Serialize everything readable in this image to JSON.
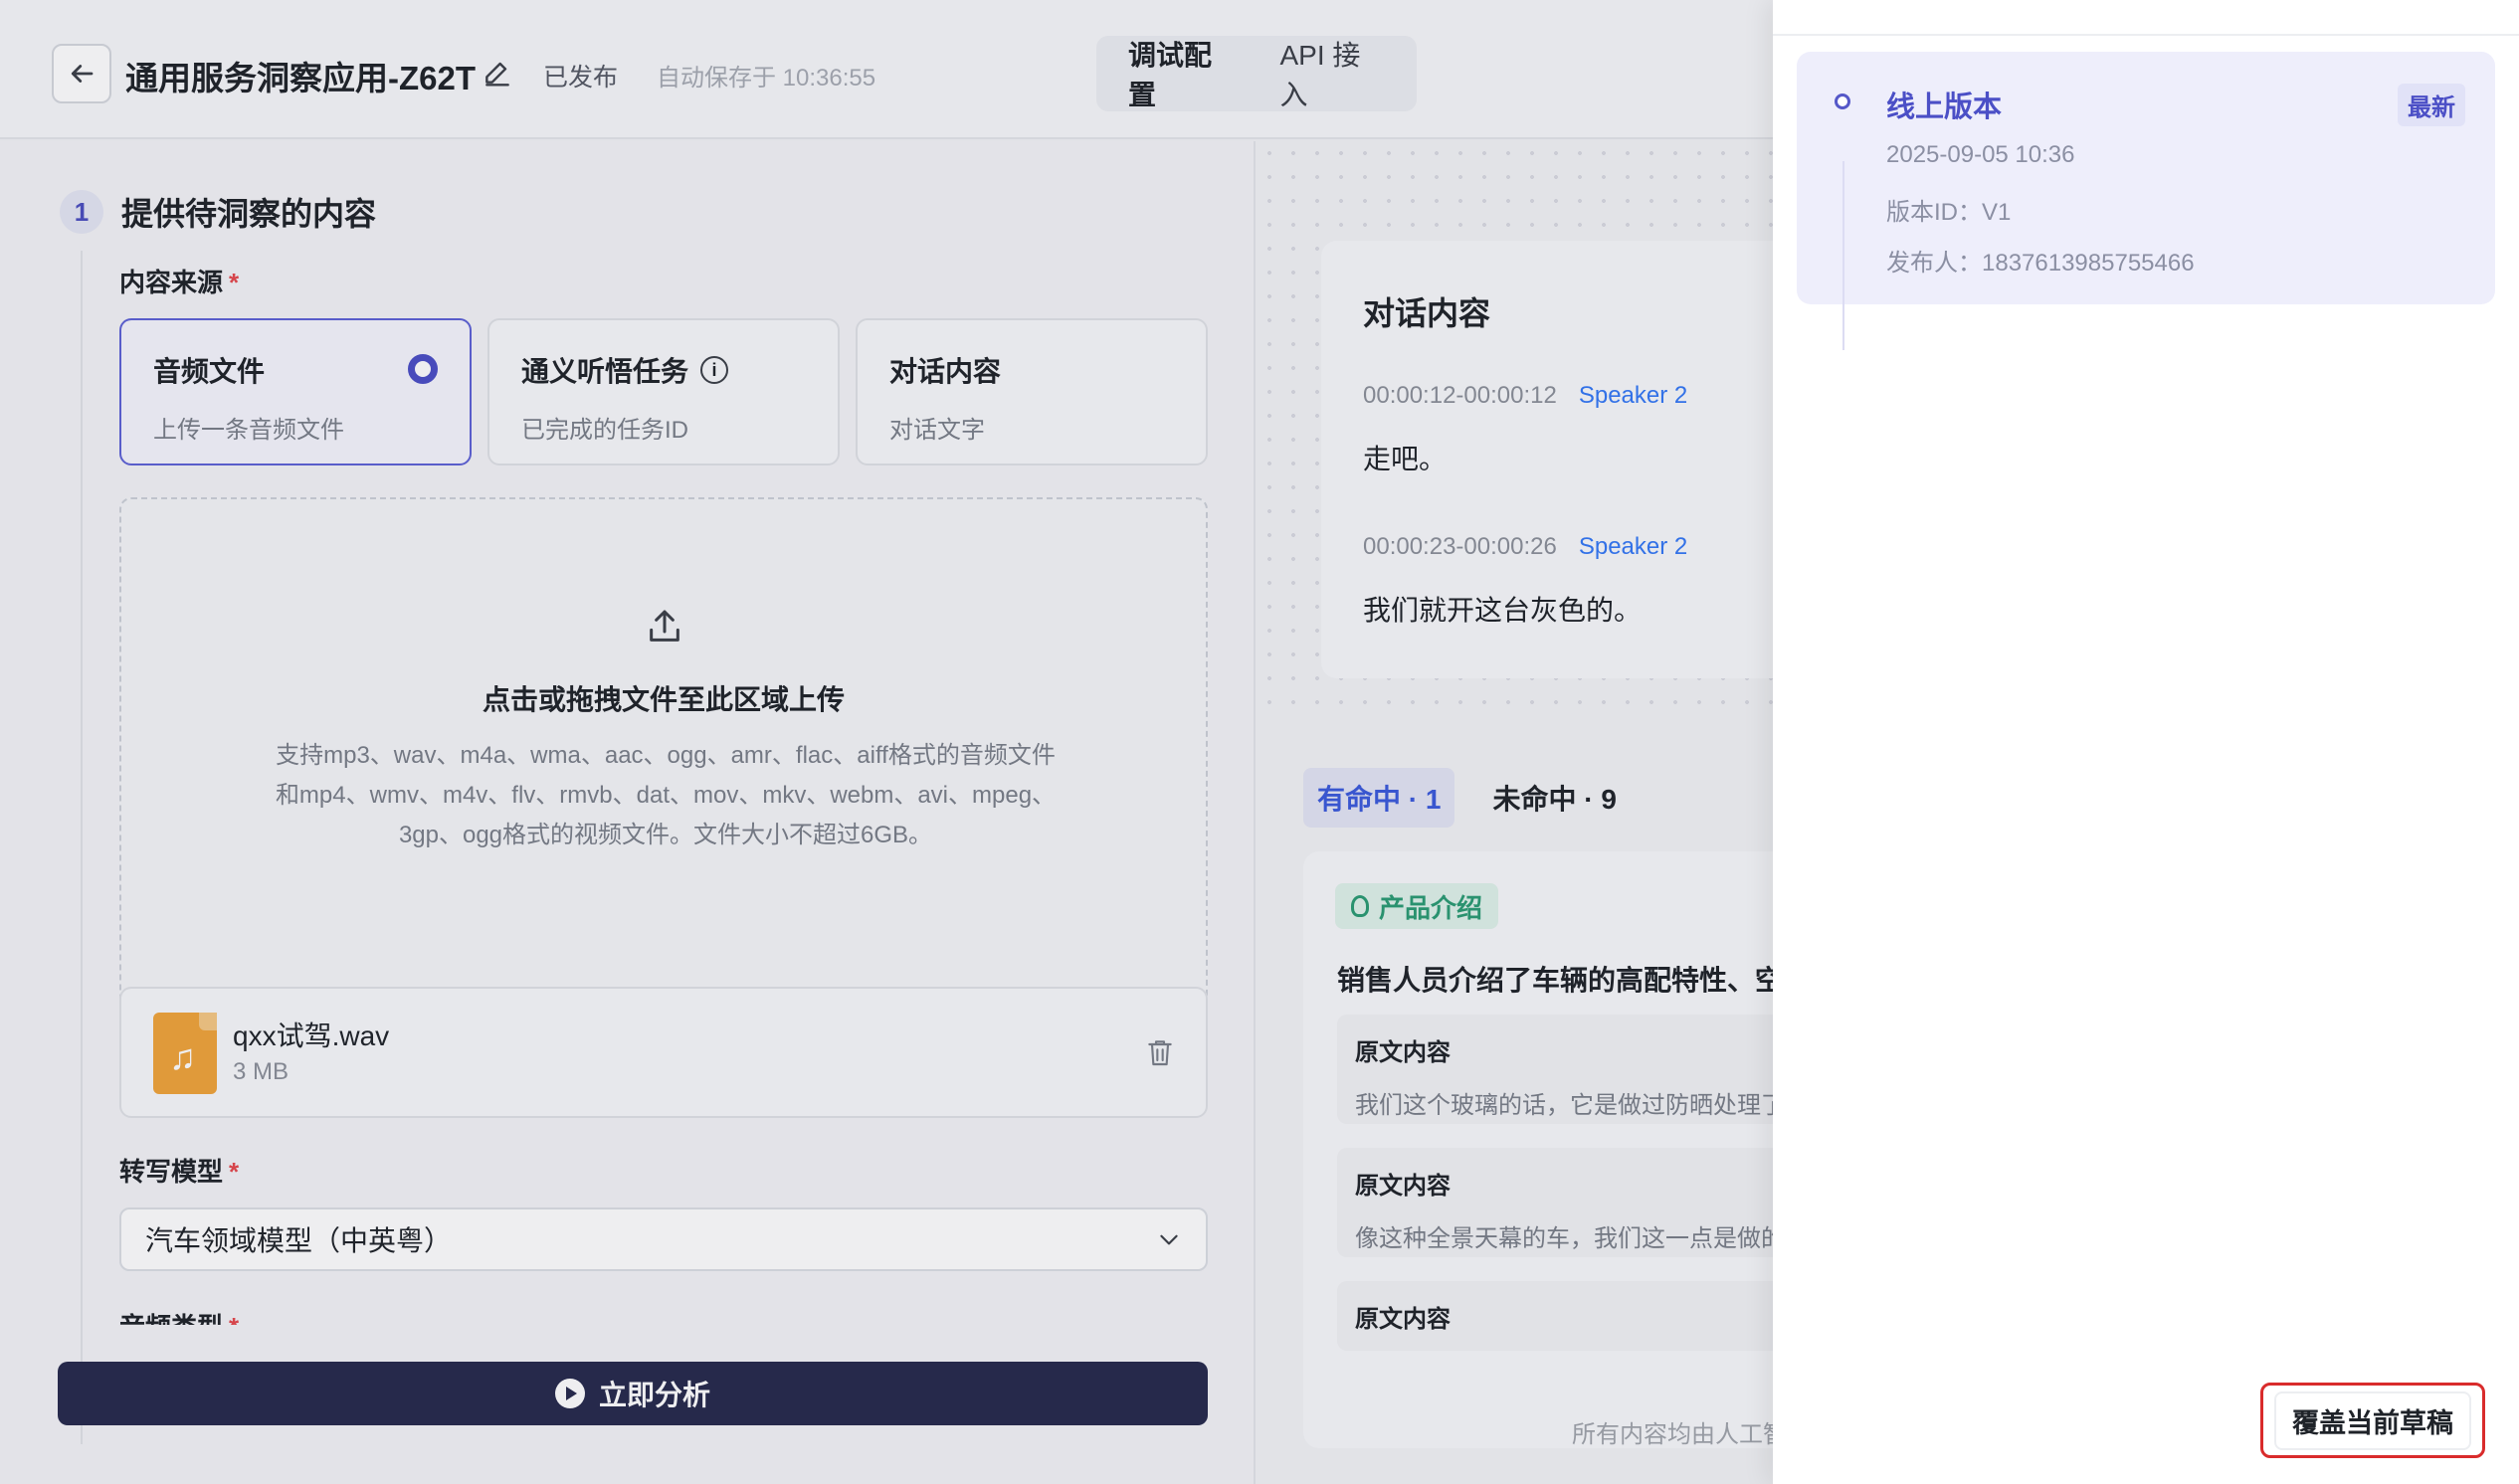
{
  "header": {
    "title": "通用服务洞察应用-Z62T",
    "status": "已发布",
    "autosave": "自动保存于 10:36:55",
    "tabs": [
      {
        "label": "调试配置"
      },
      {
        "label": "API 接入"
      }
    ]
  },
  "step1": {
    "number": "1",
    "title": "提供待洞察的内容",
    "source_label": "内容来源",
    "required_mark": "*",
    "sources": [
      {
        "title": "音频文件",
        "desc": "上传一条音频文件"
      },
      {
        "title": "通义听悟任务",
        "desc": "已完成的任务ID"
      },
      {
        "title": "对话内容",
        "desc": "对话文字"
      }
    ],
    "upload": {
      "title": "点击或拖拽文件至此区域上传",
      "desc": "支持mp3、wav、m4a、wma、aac、ogg、amr、flac、aiff格式的音频文件和mp4、wmv、m4v、flv、rmvb、dat、mov、mkv、webm、avi、mpeg、3gp、ogg格式的视频文件。文件大小不超过6GB。"
    },
    "file": {
      "name": "qxx试驾.wav",
      "size": "3 MB"
    },
    "model_label": "转写模型",
    "model_value": "汽车领域模型（中英粤）",
    "next_label": "音频类型"
  },
  "analyze_button": "立即分析",
  "dialog": {
    "title": "对话内容",
    "segments": [
      {
        "time": "00:00:12-00:00:12",
        "speaker": "Speaker 2",
        "text": "走吧。"
      },
      {
        "time": "00:00:23-00:00:26",
        "speaker": "Speaker 2",
        "text": "我们就开这台灰色的。"
      }
    ]
  },
  "results": {
    "hit_tab": "有命中 · 1",
    "miss_tab": "未命中 · 9",
    "tag": "产品介绍",
    "summary": "销售人员介绍了车辆的高配特性、空",
    "originals": [
      {
        "heading": "原文内容",
        "body": "我们这个玻璃的话，它是做过防晒处理了"
      },
      {
        "heading": "原文内容",
        "body": "像这种全景天幕的车，我们这一点是做的"
      },
      {
        "heading": "原文内容",
        "body": ""
      }
    ],
    "footnote": "所有内容均由人工智"
  },
  "drawer": {
    "version_name": "线上版本",
    "latest": "最新",
    "datetime": "2025-09-05 10:36",
    "version_id": "版本ID：V1",
    "publisher": "发布人：1837613985755466",
    "overwrite_button": "覆盖当前草稿"
  }
}
